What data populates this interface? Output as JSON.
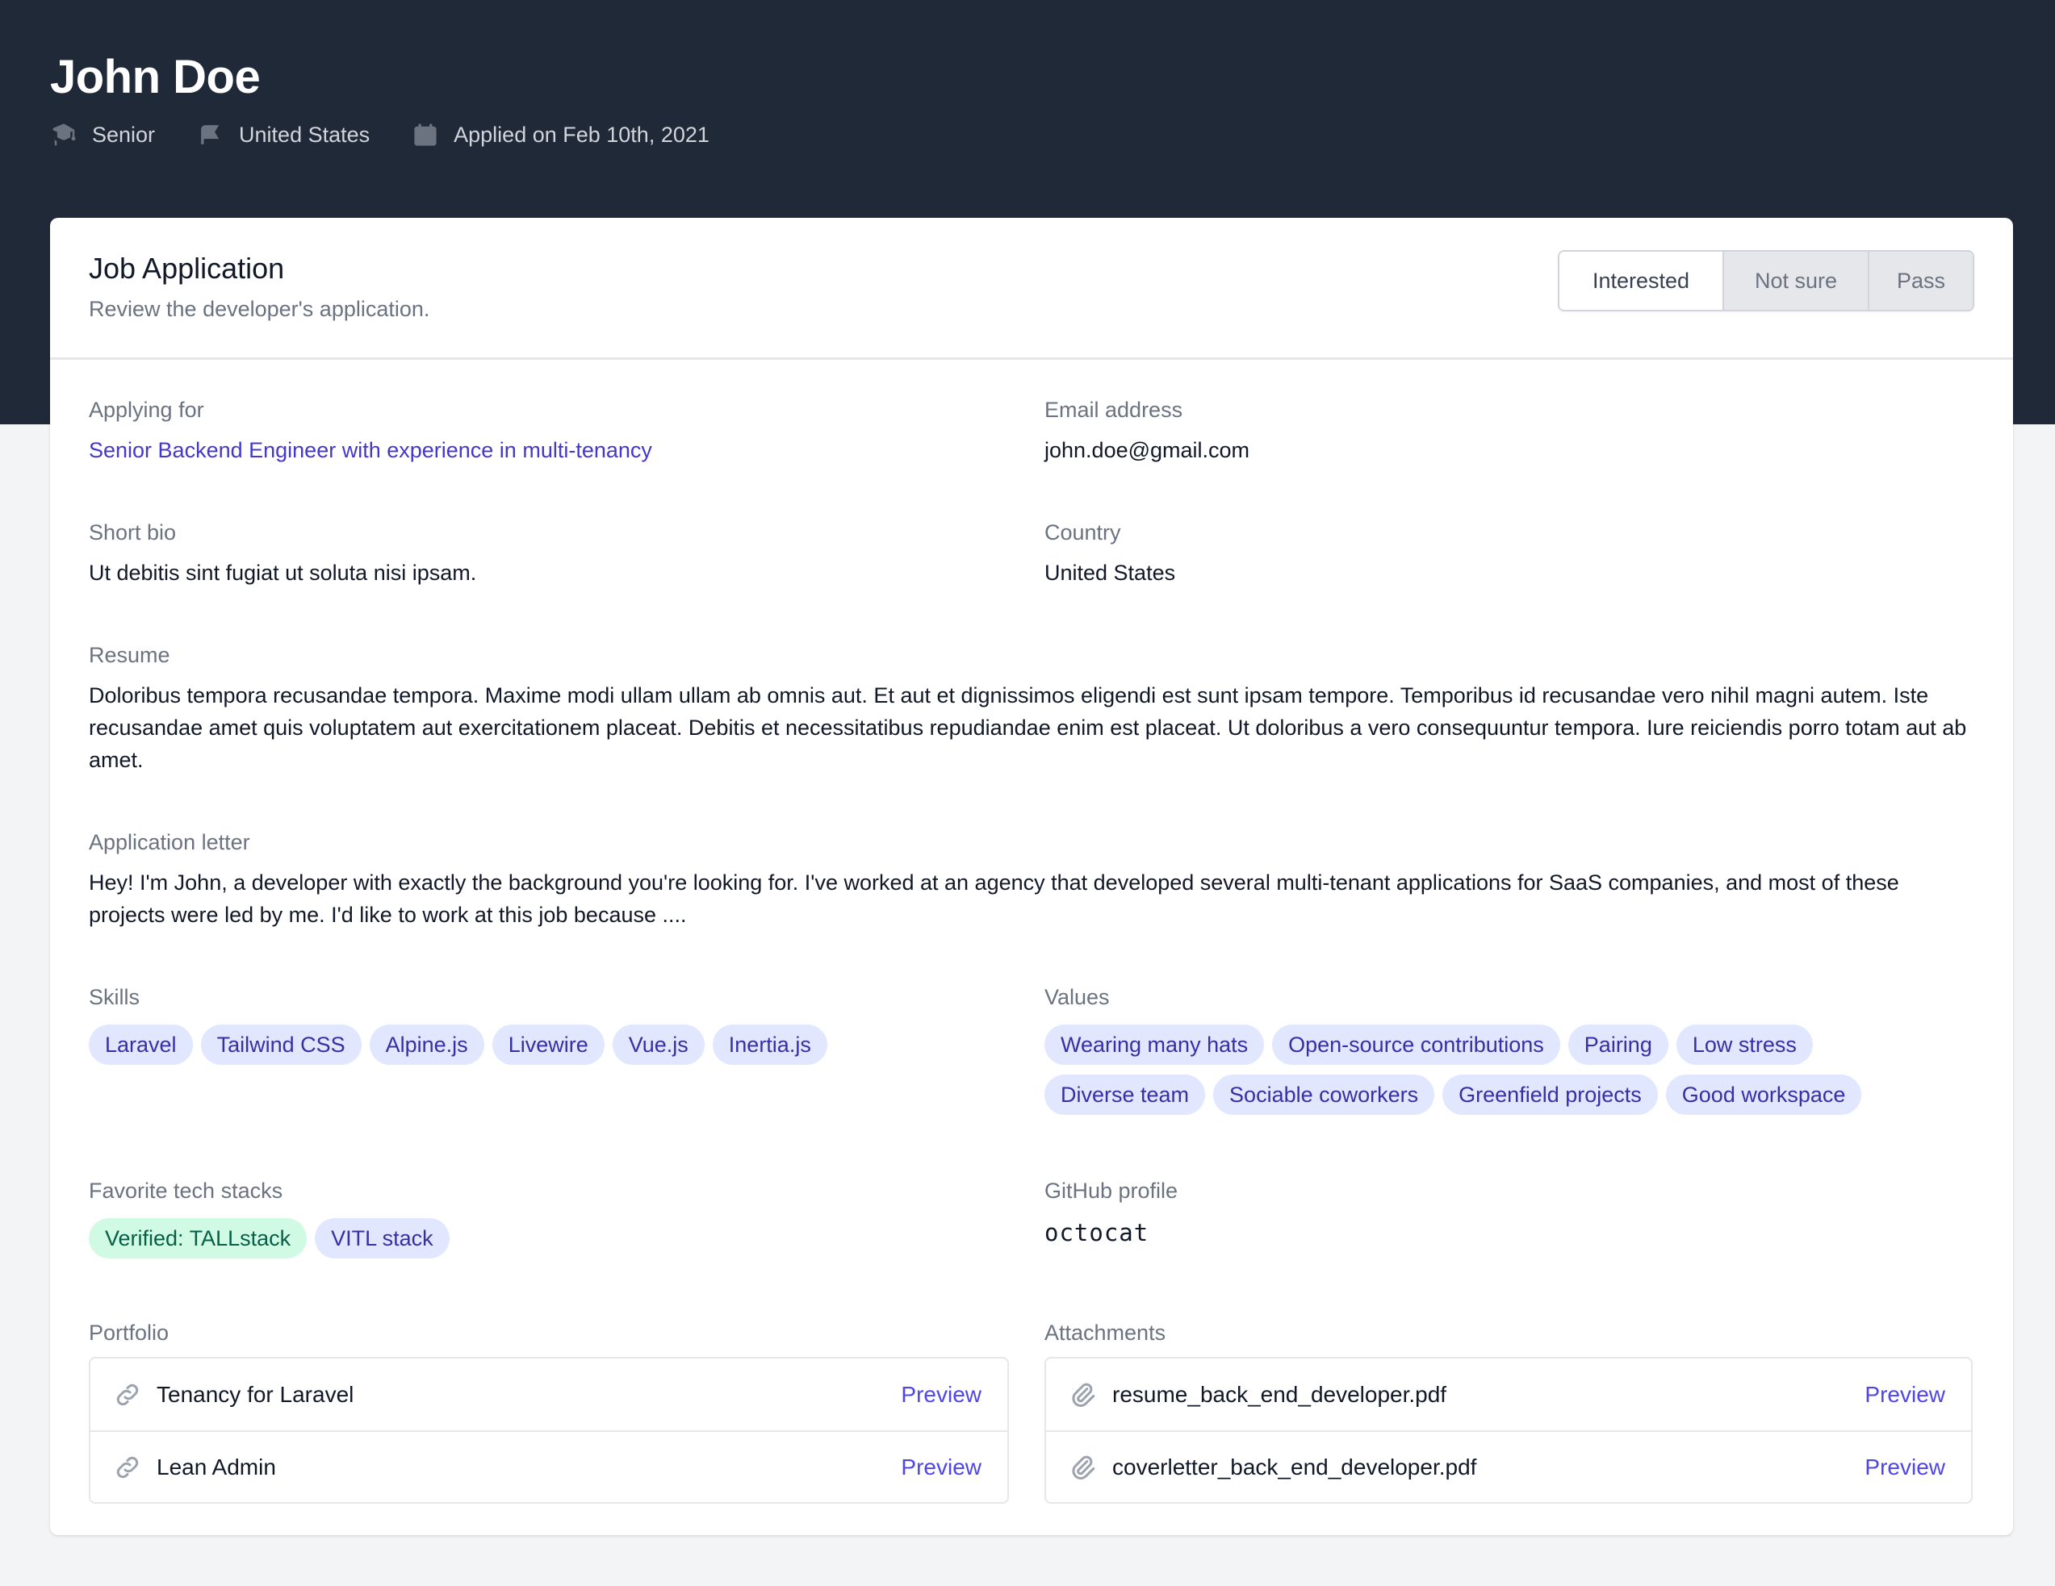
{
  "header": {
    "name": "John Doe",
    "meta": [
      {
        "icon": "academic-cap-icon",
        "label": "Senior"
      },
      {
        "icon": "flag-icon",
        "label": "United States"
      },
      {
        "icon": "calendar-icon",
        "label": "Applied on Feb 10th, 2021"
      }
    ]
  },
  "card": {
    "title": "Job Application",
    "subtitle": "Review the developer's application.",
    "decision_buttons": [
      {
        "label": "Interested",
        "selected": true
      },
      {
        "label": "Not sure",
        "selected": false
      },
      {
        "label": "Pass",
        "selected": false
      }
    ]
  },
  "fields": {
    "applying_for": {
      "label": "Applying for",
      "value": "Senior Backend Engineer with experience in multi-tenancy"
    },
    "email": {
      "label": "Email address",
      "value": "john.doe@gmail.com"
    },
    "short_bio": {
      "label": "Short bio",
      "value": "Ut debitis sint fugiat ut soluta nisi ipsam."
    },
    "country": {
      "label": "Country",
      "value": "United States"
    },
    "resume": {
      "label": "Resume",
      "value": "Doloribus tempora recusandae tempora. Maxime modi ullam ullam ab omnis aut. Et aut et dignissimos eligendi est sunt ipsam tempore. Temporibus id recusandae vero nihil magni autem. Iste recusandae amet quis voluptatem aut exercitationem placeat. Debitis et necessitatibus repudiandae enim est placeat. Ut doloribus a vero consequuntur tempora. Iure reiciendis porro totam aut ab amet."
    },
    "application_letter": {
      "label": "Application letter",
      "value": "Hey! I'm John, a developer with exactly the background you're looking for. I've worked at an agency that developed several multi-tenant applications for SaaS companies, and most of these projects were led by me. I'd like to work at this job because ...."
    },
    "skills": {
      "label": "Skills",
      "items": [
        "Laravel",
        "Tailwind CSS",
        "Alpine.js",
        "Livewire",
        "Vue.js",
        "Inertia.js"
      ]
    },
    "values": {
      "label": "Values",
      "items": [
        "Wearing many hats",
        "Open-source contributions",
        "Pairing",
        "Low stress",
        "Diverse team",
        "Sociable coworkers",
        "Greenfield projects",
        "Good workspace"
      ]
    },
    "tech_stacks": {
      "label": "Favorite tech stacks",
      "items": [
        {
          "label": "Verified: TALLstack",
          "verified": true
        },
        {
          "label": "VITL stack",
          "verified": false
        }
      ]
    },
    "github": {
      "label": "GitHub profile",
      "value": "octocat"
    },
    "portfolio": {
      "label": "Portfolio",
      "items": [
        {
          "name": "Tenancy for Laravel",
          "action": "Preview"
        },
        {
          "name": "Lean Admin",
          "action": "Preview"
        }
      ]
    },
    "attachments": {
      "label": "Attachments",
      "items": [
        {
          "name": "resume_back_end_developer.pdf",
          "action": "Preview"
        },
        {
          "name": "coverletter_back_end_developer.pdf",
          "action": "Preview"
        }
      ]
    }
  },
  "colors": {
    "hero_bg": "#1f2937",
    "accent": "#4f46e5",
    "pill_bg": "#e0e7ff",
    "pill_text": "#3730a3",
    "verified_bg": "#d1fae5",
    "verified_text": "#065f46"
  }
}
